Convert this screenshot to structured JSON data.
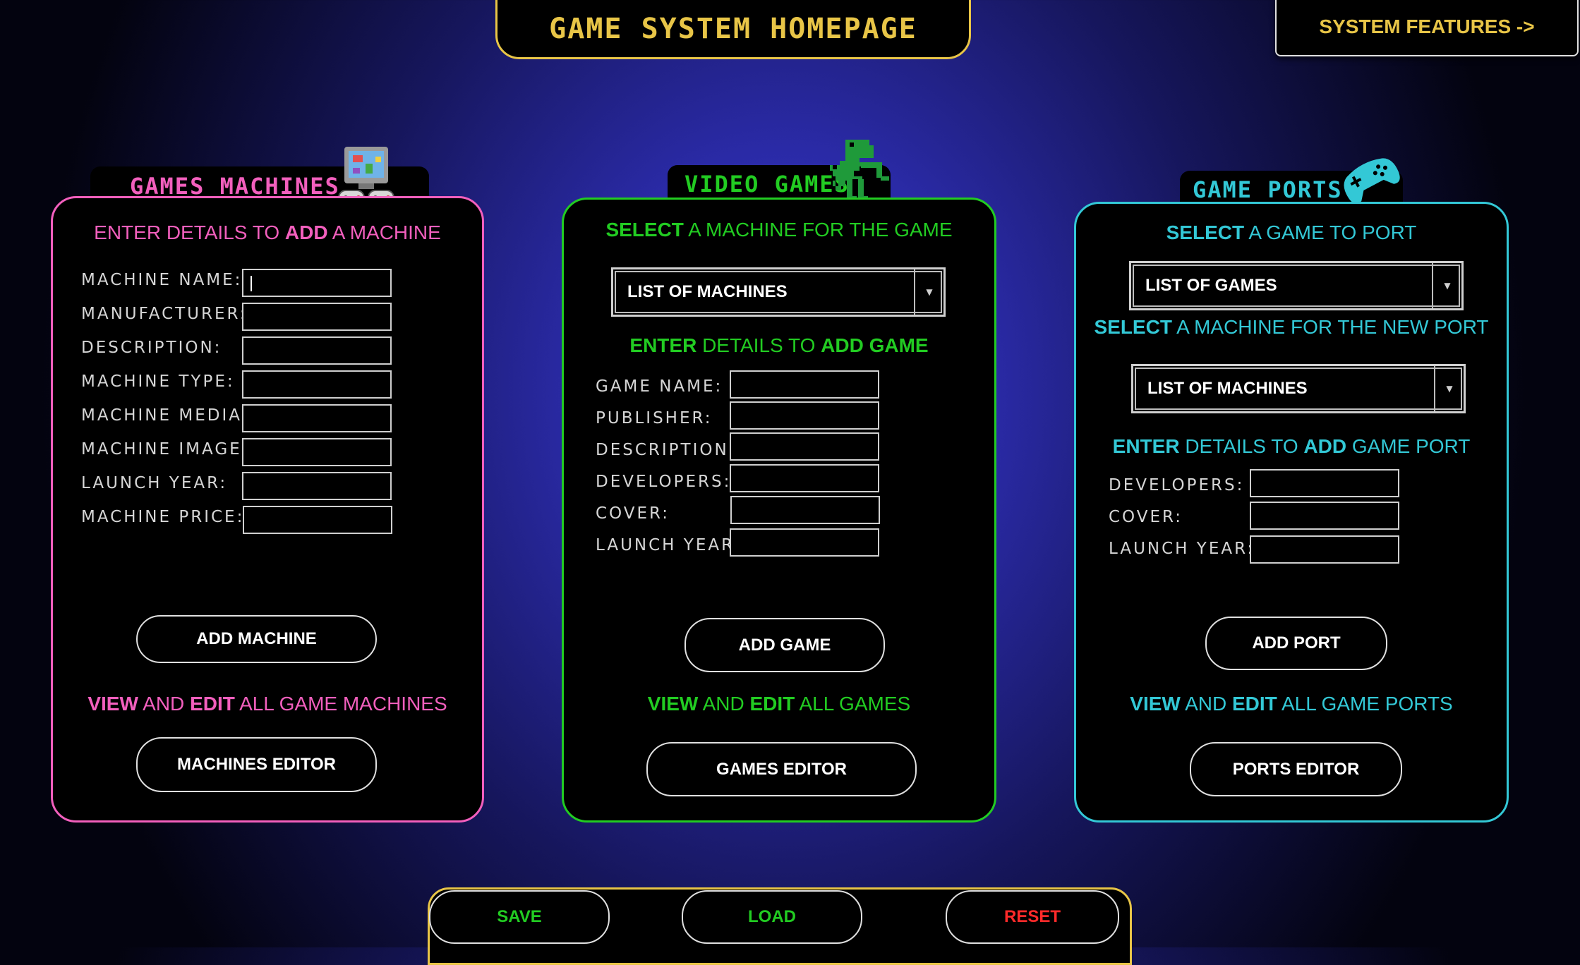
{
  "header": {
    "title": "GAME SYSTEM HOMEPAGE",
    "features_button": "SYSTEM FEATURES ->"
  },
  "colors": {
    "machines": "#f25fbd",
    "games": "#22cc22",
    "ports": "#33c8d6",
    "gold": "#e8c547",
    "reset": "#ff2a2a"
  },
  "machines": {
    "tab_title": "GAMES MACHINES",
    "icon": "retro-computer-icon",
    "heading": {
      "pre": "ENTER DETAILS TO ",
      "bold": "ADD",
      "post": " A MACHINE"
    },
    "fields": [
      "MACHINE NAME:",
      "MANUFACTURER:",
      "DESCRIPTION:",
      "MACHINE TYPE:",
      "MACHINE MEDIA:",
      "MACHINE IMAGE:",
      "LAUNCH YEAR:",
      "MACHINE PRICE:"
    ],
    "add_button": "ADD MACHINE",
    "view_line": {
      "b1": "VIEW",
      "m1": " AND ",
      "b2": "EDIT",
      "m2": " ALL GAME MACHINES"
    },
    "editor_button": "MACHINES EDITOR"
  },
  "games": {
    "tab_title": "VIDEO GAMES",
    "icon": "dinosaur-icon",
    "select_heading": {
      "bold": "SELECT",
      "rest": " A MACHINE FOR THE GAME"
    },
    "select_value": "LIST OF MACHINES",
    "enter_heading": {
      "b1": "ENTER",
      "m1": " DETAILS TO ",
      "b2": "ADD GAME"
    },
    "fields": [
      "GAME NAME:",
      "PUBLISHER:",
      "DESCRIPTION:",
      "DEVELOPERS:",
      "COVER:",
      "LAUNCH YEAR:"
    ],
    "add_button": "ADD GAME",
    "view_line": {
      "b1": "VIEW",
      "m1": " AND ",
      "b2": "EDIT",
      "m2": " ALL GAMES"
    },
    "editor_button": "GAMES EDITOR"
  },
  "ports": {
    "tab_title": "GAME PORTS",
    "icon": "gamepad-icon",
    "select_game_heading": {
      "bold": "SELECT",
      "rest": " A GAME TO PORT"
    },
    "select_game_value": "LIST OF GAMES",
    "select_machine_heading": {
      "bold": "SELECT",
      "rest": " A MACHINE FOR THE NEW PORT"
    },
    "select_machine_value": "LIST OF MACHINES",
    "enter_heading": {
      "b1": "ENTER",
      "m1": " DETAILS TO ",
      "b2": "ADD",
      "m2": " GAME PORT"
    },
    "fields": [
      "DEVELOPERS:",
      "COVER:",
      "LAUNCH YEAR:"
    ],
    "add_button": "ADD PORT",
    "view_line": {
      "b1": "VIEW",
      "m1": " AND ",
      "b2": "EDIT",
      "m2": " ALL GAME PORTS"
    },
    "editor_button": "PORTS EDITOR"
  },
  "footer": {
    "save": "SAVE",
    "load": "LOAD",
    "reset": "RESET"
  }
}
